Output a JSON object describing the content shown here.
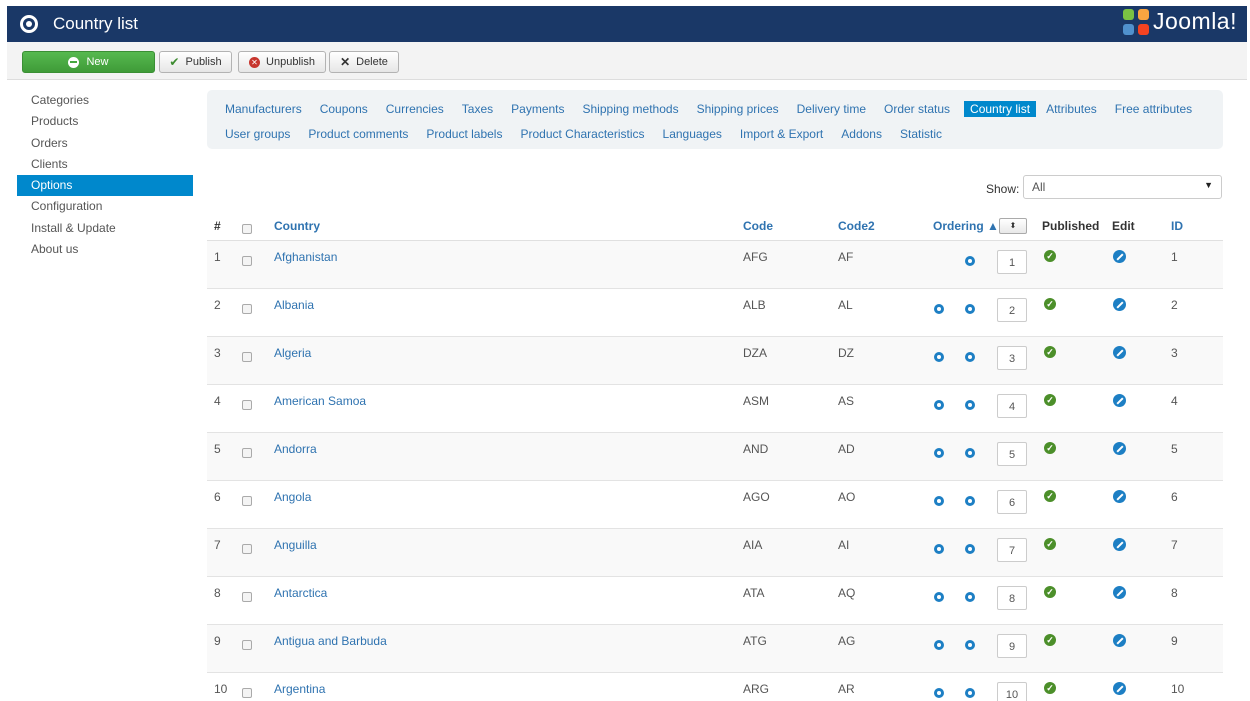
{
  "header": {
    "title": "Country list",
    "brand": "Joomla!"
  },
  "toolbar": {
    "new": "New",
    "publish": "Publish",
    "unpublish": "Unpublish",
    "delete": "Delete"
  },
  "sidebar": {
    "items": [
      {
        "label": "Categories"
      },
      {
        "label": "Products"
      },
      {
        "label": "Orders"
      },
      {
        "label": "Clients"
      },
      {
        "label": "Options",
        "active": true
      },
      {
        "label": "Configuration"
      },
      {
        "label": "Install & Update"
      },
      {
        "label": "About us"
      }
    ]
  },
  "submenu": {
    "row1": [
      "Manufacturers",
      "Coupons",
      "Currencies",
      "Taxes",
      "Payments",
      "Shipping methods",
      "Shipping prices",
      "Delivery time",
      "Order status",
      "Country list",
      "Attributes",
      "Free attributes"
    ],
    "row2": [
      "User groups",
      "Product comments",
      "Product labels",
      "Product Characteristics",
      "Languages",
      "Import & Export",
      "Addons",
      "Statistic"
    ],
    "active": "Country list"
  },
  "filter": {
    "label": "Show:",
    "value": "All"
  },
  "table": {
    "headers": {
      "num": "#",
      "country": "Country",
      "code": "Code",
      "code2": "Code2",
      "ordering": "Ordering",
      "published": "Published",
      "edit": "Edit",
      "id": "ID"
    },
    "rows": [
      {
        "num": "1",
        "country": "Afghanistan",
        "code": "AFG",
        "code2": "AF",
        "order": "1",
        "id": "1"
      },
      {
        "num": "2",
        "country": "Albania",
        "code": "ALB",
        "code2": "AL",
        "order": "2",
        "id": "2"
      },
      {
        "num": "3",
        "country": "Algeria",
        "code": "DZA",
        "code2": "DZ",
        "order": "3",
        "id": "3"
      },
      {
        "num": "4",
        "country": "American Samoa",
        "code": "ASM",
        "code2": "AS",
        "order": "4",
        "id": "4"
      },
      {
        "num": "5",
        "country": "Andorra",
        "code": "AND",
        "code2": "AD",
        "order": "5",
        "id": "5"
      },
      {
        "num": "6",
        "country": "Angola",
        "code": "AGO",
        "code2": "AO",
        "order": "6",
        "id": "6"
      },
      {
        "num": "7",
        "country": "Anguilla",
        "code": "AIA",
        "code2": "AI",
        "order": "7",
        "id": "7"
      },
      {
        "num": "8",
        "country": "Antarctica",
        "code": "ATA",
        "code2": "AQ",
        "order": "8",
        "id": "8"
      },
      {
        "num": "9",
        "country": "Antigua and Barbuda",
        "code": "ATG",
        "code2": "AG",
        "order": "9",
        "id": "9"
      },
      {
        "num": "10",
        "country": "Argentina",
        "code": "ARG",
        "code2": "AR",
        "order": "10",
        "id": "10"
      }
    ]
  },
  "colors": {
    "header": "#1a3867",
    "accent": "#0088cc",
    "link": "#2f73b0",
    "new_button": "#46a83f"
  }
}
